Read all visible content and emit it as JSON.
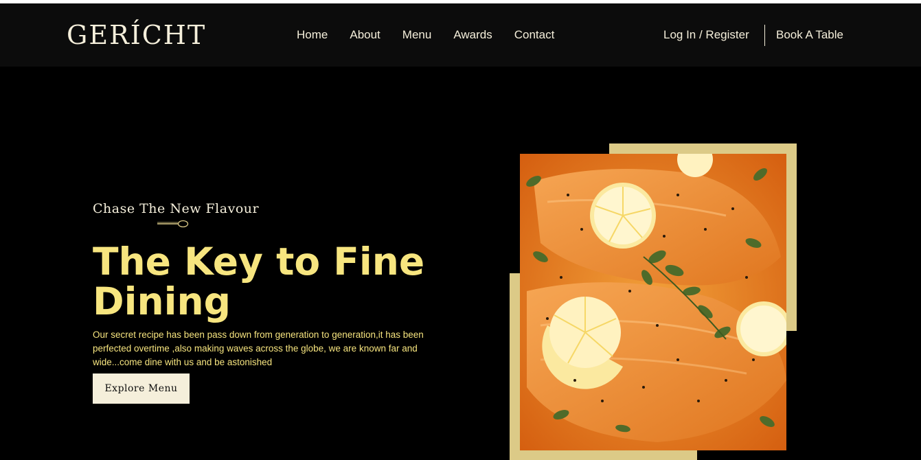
{
  "brand": {
    "logo_text": "GERÍCHT"
  },
  "nav": {
    "links": [
      "Home",
      "About",
      "Menu",
      "Awards",
      "Contact"
    ],
    "login_label": "Log In / Register",
    "book_label": "Book A Table"
  },
  "hero": {
    "subtitle": "Chase The New Flavour",
    "headline": "The Key to Fine Dining",
    "description": "Our secret recipe has been pass down from generation to generation,it has been perfected overtime ,also making waves across the globe, we are known far and wide...come dine with us and be astonished",
    "button_label": "Explore Menu",
    "image_icon": "salmon-dish-image"
  },
  "colors": {
    "background": "#000000",
    "navbar": "#0c0c0c",
    "gold": "#dcca87",
    "headline_yellow": "#f7e57f",
    "cream": "#f5efdb"
  }
}
